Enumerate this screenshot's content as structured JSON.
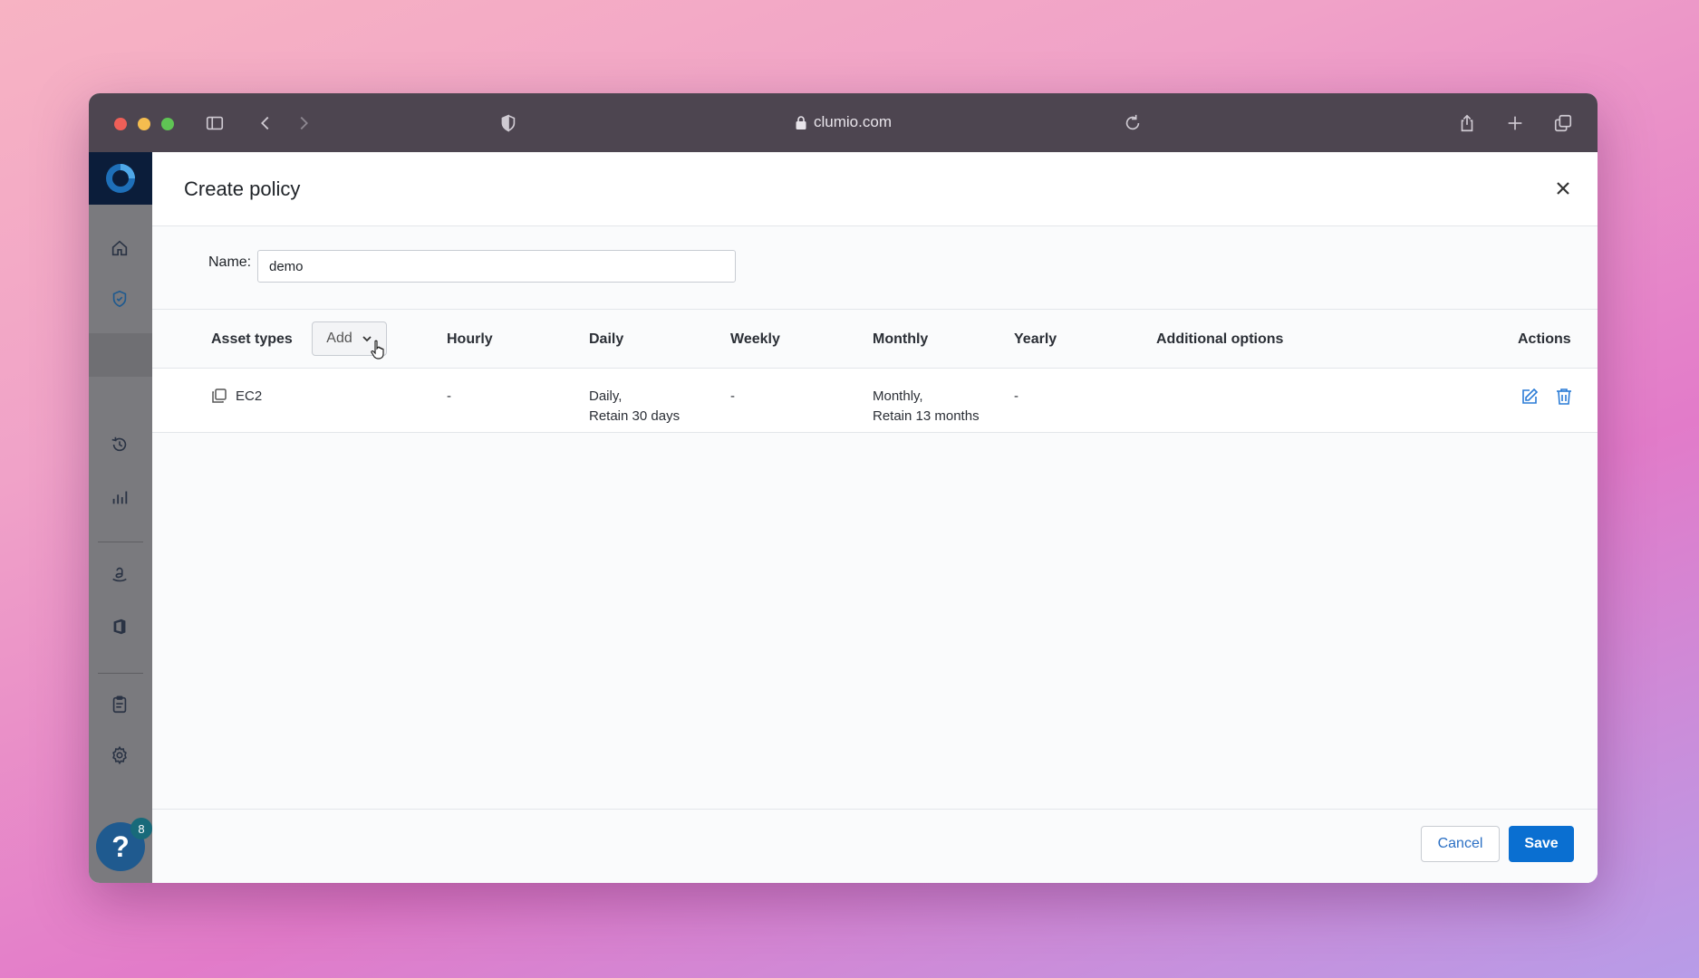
{
  "browser": {
    "url": "clumio.com",
    "traffic_colors": [
      "#ee5f58",
      "#f5bd4f",
      "#5fc454"
    ],
    "icons": [
      "sidebar-toggle-icon",
      "back-icon",
      "forward-icon",
      "privacy-shield-icon",
      "lock-icon",
      "reload-icon",
      "share-icon",
      "new-tab-icon",
      "tab-overview-icon"
    ]
  },
  "sidebar": {
    "icons": [
      "home-icon",
      "shield-check-icon",
      "history-icon",
      "bar-chart-icon",
      "amazon-icon",
      "office-icon",
      "clipboard-icon",
      "gear-icon"
    ],
    "help_label": "?",
    "help_badge": "8"
  },
  "modal": {
    "title": "Create policy",
    "name_label": "Name:",
    "name_value": "demo",
    "add_label": "Add",
    "columns": {
      "asset_types": "Asset types",
      "hourly": "Hourly",
      "daily": "Daily",
      "weekly": "Weekly",
      "monthly": "Monthly",
      "yearly": "Yearly",
      "additional": "Additional options",
      "actions": "Actions"
    },
    "rows": [
      {
        "asset": "EC2",
        "hourly": "-",
        "daily_line1": "Daily,",
        "daily_line2": "Retain 30 days",
        "weekly": "-",
        "monthly_line1": "Monthly,",
        "monthly_line2": "Retain 13 months",
        "yearly": "-"
      }
    ],
    "cancel_label": "Cancel",
    "save_label": "Save"
  },
  "colors": {
    "accent": "#0a6fd1",
    "sidebar_bg": "#7a7a7e",
    "titlebar_bg": "#4d4550"
  }
}
